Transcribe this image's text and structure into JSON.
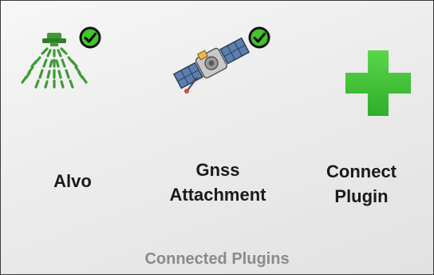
{
  "plugins": [
    {
      "name_line1": "Alvo",
      "name_line2": "",
      "icon": "sprayer-nozzle-icon",
      "connected": true,
      "status_icon": "check-circle-icon"
    },
    {
      "name_line1": "Gnss",
      "name_line2": "Attachment",
      "icon": "satellite-icon",
      "connected": true,
      "status_icon": "check-circle-icon"
    },
    {
      "name_line1": "Connect",
      "name_line2": "Plugin",
      "icon": "plus-icon",
      "connected": false
    }
  ],
  "footer": {
    "title": "Connected Plugins"
  },
  "colors": {
    "accent_green": "#3ec13e",
    "badge_green": "#42c62b",
    "spray_green": "#3f9a36",
    "label_text": "#1a1a1a",
    "footer_text": "#8a8a8a"
  }
}
